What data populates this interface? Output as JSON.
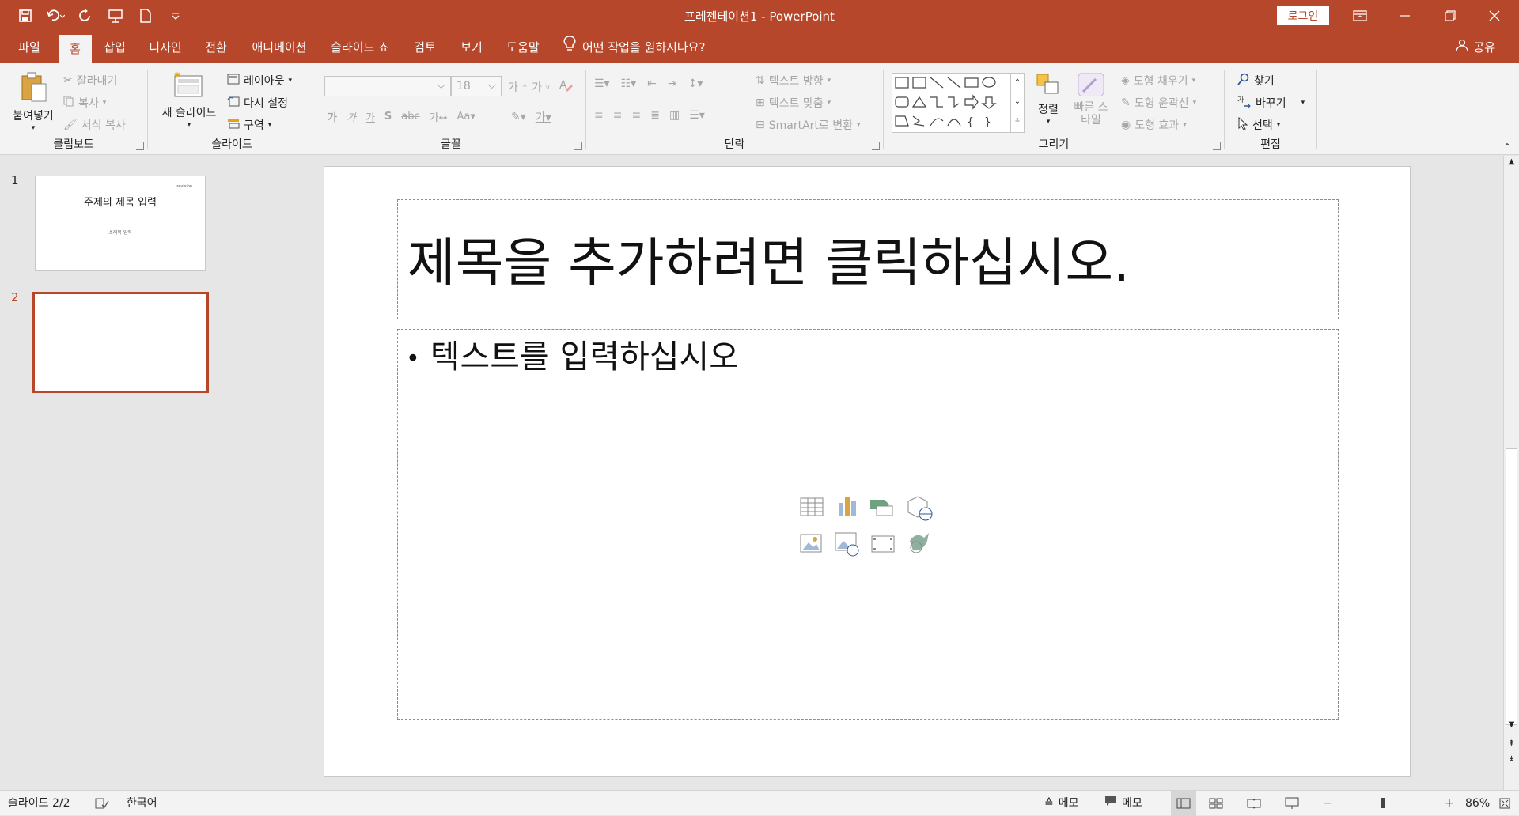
{
  "window": {
    "title": "프레젠테이션1  -  PowerPoint",
    "login_label": "로그인"
  },
  "tabs": [
    {
      "label": "파일"
    },
    {
      "label": "홈"
    },
    {
      "label": "삽입"
    },
    {
      "label": "디자인"
    },
    {
      "label": "전환"
    },
    {
      "label": "애니메이션"
    },
    {
      "label": "슬라이드 쇼"
    },
    {
      "label": "검토"
    },
    {
      "label": "보기"
    },
    {
      "label": "도움말"
    }
  ],
  "tellme": {
    "placeholder": "어떤 작업을 원하시나요?"
  },
  "share": {
    "label": "공유"
  },
  "ribbon": {
    "clipboard": {
      "label": "클립보드",
      "paste": "붙여넣기",
      "cut": "잘라내기",
      "copy": "복사",
      "format_painter": "서식 복사"
    },
    "slides": {
      "label": "슬라이드",
      "new_slide": "새 슬라이드",
      "layout": "레이아웃",
      "reset": "다시 설정",
      "section": "구역"
    },
    "font": {
      "label": "글꼴",
      "font_size": "18"
    },
    "paragraph": {
      "label": "단락",
      "text_direction": "텍스트 방향",
      "align_text": "텍스트 맞춤",
      "smartart": "SmartArt로 변환"
    },
    "drawing": {
      "label": "그리기",
      "arrange": "정렬",
      "quick_styles": "빠른 스타일",
      "shape_fill": "도형 채우기",
      "shape_outline": "도형 윤곽선",
      "shape_effects": "도형 효과"
    },
    "editing": {
      "label": "편집",
      "find": "찾기",
      "replace": "바꾸기",
      "select": "선택"
    }
  },
  "thumbnails": [
    {
      "number": "1",
      "title": "주제의 제목 입력",
      "subtitle": "소제목 입력",
      "tag": "revision"
    },
    {
      "number": "2"
    }
  ],
  "slide": {
    "title_placeholder": "제목을 추가하려면 클릭하십시오.",
    "body_placeholder": "텍스트를 입력하십시오"
  },
  "status": {
    "slide_indicator": "슬라이드 2/2",
    "language": "한국어",
    "notes": "메모",
    "comments": "메모",
    "zoom": "86%"
  },
  "colors": {
    "accent": "#b7472a"
  }
}
